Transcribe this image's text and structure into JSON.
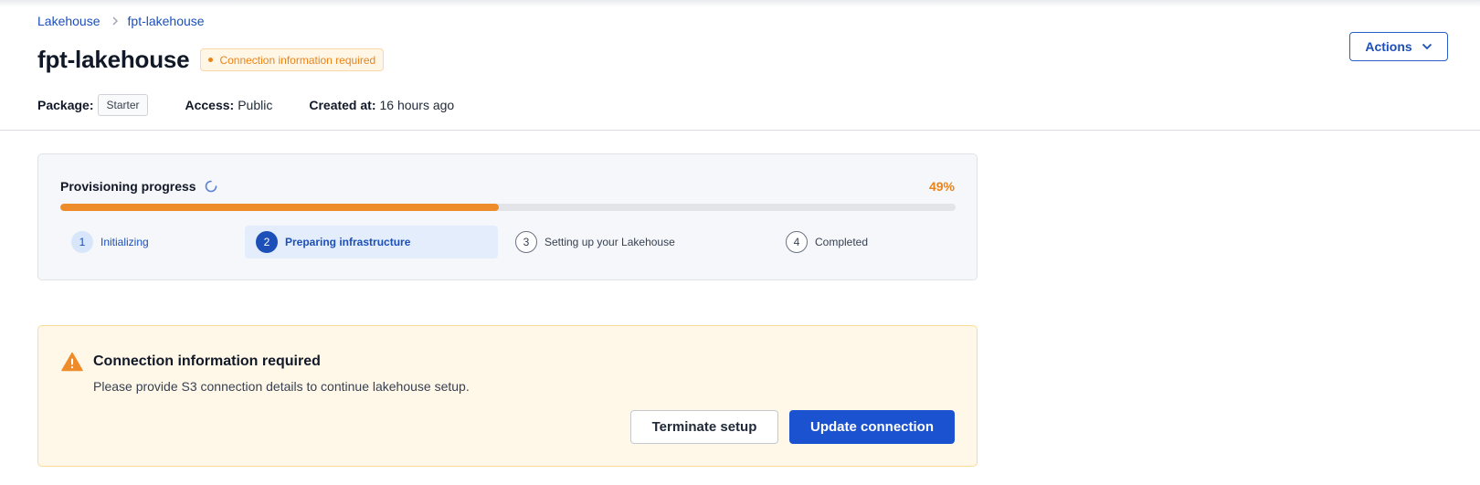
{
  "breadcrumb": {
    "parent": "Lakehouse",
    "current": "fpt-lakehouse"
  },
  "header": {
    "title": "fpt-lakehouse",
    "status_badge": "Connection information required",
    "actions_label": "Actions"
  },
  "meta": {
    "package_label": "Package:",
    "package_value": "Starter",
    "access_label": "Access:",
    "access_value": "Public",
    "created_label": "Created at:",
    "created_value": "16 hours ago"
  },
  "progress": {
    "title": "Provisioning progress",
    "percent_label": "49%",
    "fraction": 0.49,
    "steps": [
      {
        "number": "1",
        "label": "Initializing",
        "state": "done"
      },
      {
        "number": "2",
        "label": "Preparing infrastructure",
        "state": "active"
      },
      {
        "number": "3",
        "label": "Setting up your Lakehouse",
        "state": "pending"
      },
      {
        "number": "4",
        "label": "Completed",
        "state": "pending"
      }
    ]
  },
  "alert": {
    "title": "Connection information required",
    "message": "Please provide S3 connection details to continue lakehouse setup.",
    "terminate_label": "Terminate setup",
    "update_label": "Update connection"
  },
  "icons": {
    "breadcrumb_separator": "chevron-right-icon",
    "actions_caret": "chevron-down-icon",
    "progress_spinner": "spinner-icon",
    "alert": "warning-icon"
  },
  "colors": {
    "brand_blue": "#1a52d0",
    "warning_orange": "#e8841a",
    "progress_fill": "#ee8c2b",
    "alert_bg": "#fff8e9"
  }
}
